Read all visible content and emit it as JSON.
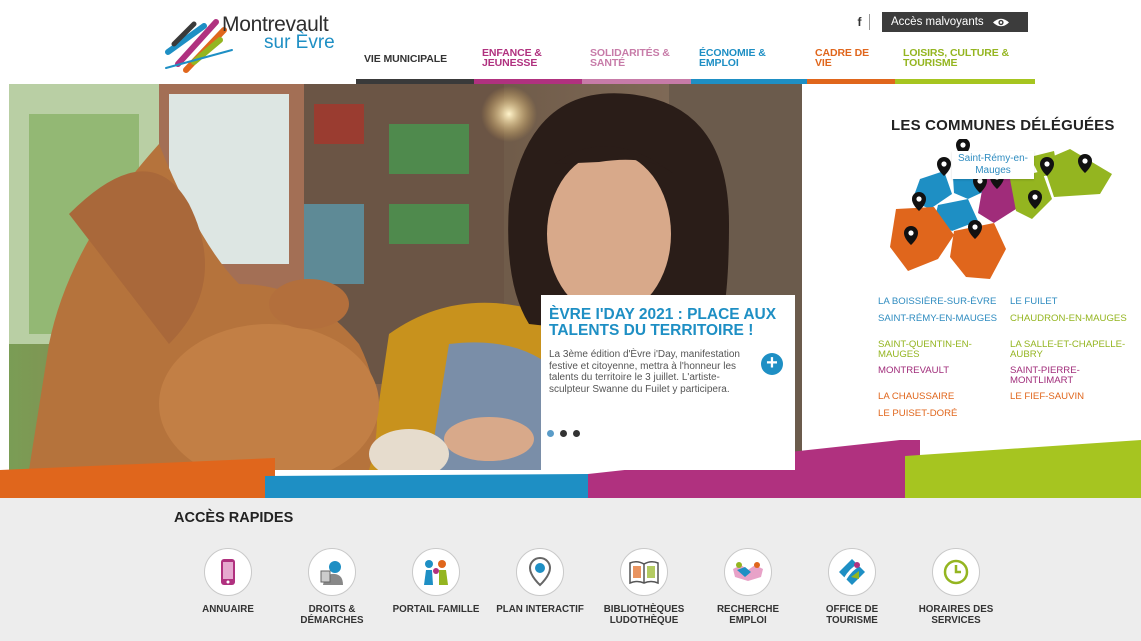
{
  "header": {
    "logo": {
      "name": "Montrevault",
      "sub": "sur Èvre"
    },
    "facebook_label": "f",
    "accessibility_label": "Accès malvoyants",
    "nav": [
      {
        "line1": "VIE MUNICIPALE",
        "line2": "",
        "color": "#333333",
        "bar": "#3a3a3a"
      },
      {
        "line1": "ENFANCE &",
        "line2": "JEUNESSE",
        "color": "#b0317f",
        "bar": "#b0317f"
      },
      {
        "line1": "SOLIDARITÉS &",
        "line2": "SANTÉ",
        "color": "#c77ba8",
        "bar": "#c77ba8"
      },
      {
        "line1": "ÉCONOMIE &",
        "line2": "EMPLOI",
        "color": "#1e8fc4",
        "bar": "#1e8fc4"
      },
      {
        "line1": "CADRE DE",
        "line2": "VIE",
        "color": "#e0661c",
        "bar": "#e0661c"
      },
      {
        "line1": "LOISIRS, CULTURE &",
        "line2": "TOURISME",
        "color": "#94b520",
        "bar": "#a6c520"
      }
    ]
  },
  "slide": {
    "title": "ÈVRE I'DAY 2021 : PLACE AUX TALENTS DU TERRITOIRE !",
    "text": "La 3ème édition d'Èvre i'Day, manifestation festive et citoyenne, mettra à l'honneur les talents du territoire le 3 juillet. L'artiste-sculpteur Swanne du Fuilet y participera.",
    "plus_label": "+"
  },
  "communes": {
    "title": "LES COMMUNES DÉLÉGUÉES",
    "tooltip": "Saint-Rémy-en-Mauges",
    "list": [
      {
        "name": "LA BOISSIÈRE-SUR-ÈVRE",
        "color": "#2f8cc0"
      },
      {
        "name": "LE FUILET",
        "color": "#2f8cc0"
      },
      {
        "name": "SAINT-RÉMY-EN-MAUGES",
        "color": "#2f8cc0"
      },
      {
        "name": "CHAUDRON-EN-MAUGES",
        "color": "#94b520"
      },
      {
        "name": "SAINT-QUENTIN-EN-MAUGES",
        "color": "#94b520"
      },
      {
        "name": "LA SALLE-ET-CHAPELLE-AUBRY",
        "color": "#94b520"
      },
      {
        "name": "MONTREVAULT",
        "color": "#a02c7a"
      },
      {
        "name": "SAINT-PIERRE-MONTLIMART",
        "color": "#a02c7a"
      },
      {
        "name": "LA CHAUSSAIRE",
        "color": "#e0661c"
      },
      {
        "name": "LE FIEF-SAUVIN",
        "color": "#e0661c"
      },
      {
        "name": "LE PUISET-DORÉ",
        "color": "#e0661c"
      }
    ]
  },
  "quick_access": {
    "title": "ACCÈS RAPIDES",
    "items": [
      {
        "line1": "ANNUAIRE",
        "line2": "",
        "icon": "phone-icon"
      },
      {
        "line1": "DROITS &",
        "line2": "DÉMARCHES",
        "icon": "person-document-icon"
      },
      {
        "line1": "PORTAIL FAMILLE",
        "line2": "",
        "icon": "family-icon"
      },
      {
        "line1": "PLAN INTERACTIF",
        "line2": "",
        "icon": "map-pin-icon"
      },
      {
        "line1": "BIBLIOTHÈQUES",
        "line2": "LUDOTHÈQUE",
        "icon": "book-icon"
      },
      {
        "line1": "RECHERCHE",
        "line2": "EMPLOI",
        "icon": "handshake-icon"
      },
      {
        "line1": "OFFICE DE",
        "line2": "TOURISME",
        "icon": "tourism-icon"
      },
      {
        "line1": "HORAIRES DES",
        "line2": "SERVICES",
        "icon": "clock-icon"
      }
    ]
  }
}
